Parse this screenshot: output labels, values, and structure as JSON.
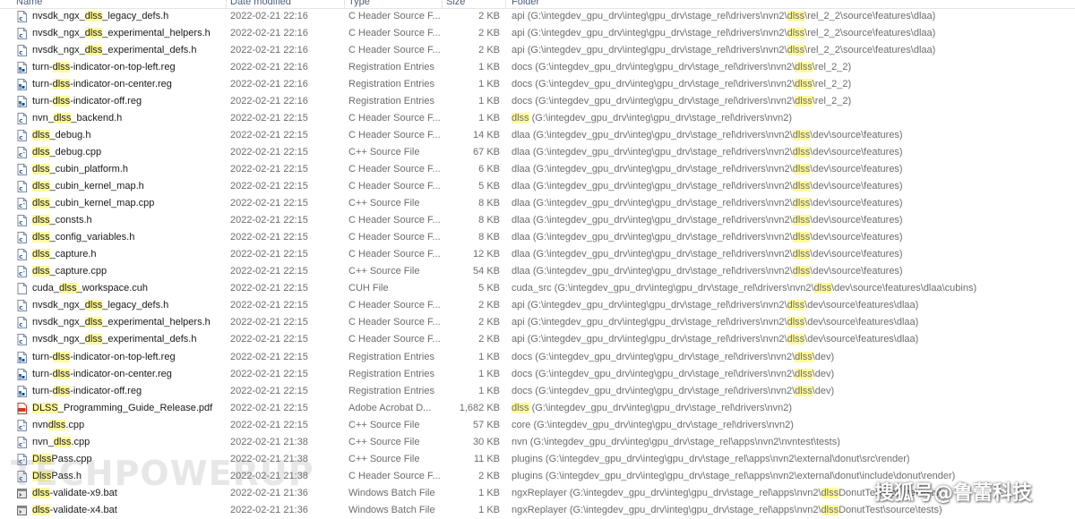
{
  "columns": {
    "name": "Name",
    "date": "Date modified",
    "type": "Type",
    "size": "Size",
    "folder": "Folder"
  },
  "highlight_term": "dlss",
  "highlight_color": "#fffa9a",
  "rows": [
    {
      "icon": "c-header-file-icon",
      "name": "nvsdk_ngx_dlss_legacy_defs.h",
      "date": "2022-02-21 22:16",
      "type": "C Header Source F...",
      "size": "2 KB",
      "folder": "api (G:\\integdev_gpu_drv\\integ\\gpu_drv\\stage_rel\\drivers\\nvn2\\dlss\\rel_2_2\\source\\features\\dlaa)"
    },
    {
      "icon": "c-header-file-icon",
      "name": "nvsdk_ngx_dlss_experimental_helpers.h",
      "date": "2022-02-21 22:16",
      "type": "C Header Source F...",
      "size": "2 KB",
      "folder": "api (G:\\integdev_gpu_drv\\integ\\gpu_drv\\stage_rel\\drivers\\nvn2\\dlss\\rel_2_2\\source\\features\\dlaa)"
    },
    {
      "icon": "c-header-file-icon",
      "name": "nvsdk_ngx_dlss_experimental_defs.h",
      "date": "2022-02-21 22:16",
      "type": "C Header Source F...",
      "size": "2 KB",
      "folder": "api (G:\\integdev_gpu_drv\\integ\\gpu_drv\\stage_rel\\drivers\\nvn2\\dlss\\rel_2_2\\source\\features\\dlaa)"
    },
    {
      "icon": "registry-file-icon",
      "name": "turn-dlss-indicator-on-top-left.reg",
      "date": "2022-02-21 22:16",
      "type": "Registration Entries",
      "size": "1 KB",
      "folder": "docs (G:\\integdev_gpu_drv\\integ\\gpu_drv\\stage_rel\\drivers\\nvn2\\dlss\\rel_2_2)"
    },
    {
      "icon": "registry-file-icon",
      "name": "turn-dlss-indicator-on-center.reg",
      "date": "2022-02-21 22:16",
      "type": "Registration Entries",
      "size": "1 KB",
      "folder": "docs (G:\\integdev_gpu_drv\\integ\\gpu_drv\\stage_rel\\drivers\\nvn2\\dlss\\rel_2_2)"
    },
    {
      "icon": "registry-file-icon",
      "name": "turn-dlss-indicator-off.reg",
      "date": "2022-02-21 22:16",
      "type": "Registration Entries",
      "size": "1 KB",
      "folder": "docs (G:\\integdev_gpu_drv\\integ\\gpu_drv\\stage_rel\\drivers\\nvn2\\dlss\\rel_2_2)"
    },
    {
      "icon": "c-header-file-icon",
      "name": "nvn_dlss_backend.h",
      "date": "2022-02-21 22:15",
      "type": "C Header Source F...",
      "size": "1 KB",
      "folder": "dlss (G:\\integdev_gpu_drv\\integ\\gpu_drv\\stage_rel\\drivers\\nvn2)"
    },
    {
      "icon": "c-header-file-icon",
      "name": "dlss_debug.h",
      "date": "2022-02-21 22:15",
      "type": "C Header Source F...",
      "size": "14 KB",
      "folder": "dlaa (G:\\integdev_gpu_drv\\integ\\gpu_drv\\stage_rel\\drivers\\nvn2\\dlss\\dev\\source\\features)"
    },
    {
      "icon": "cpp-source-file-icon",
      "name": "dlss_debug.cpp",
      "date": "2022-02-21 22:15",
      "type": "C++ Source File",
      "size": "67 KB",
      "folder": "dlaa (G:\\integdev_gpu_drv\\integ\\gpu_drv\\stage_rel\\drivers\\nvn2\\dlss\\dev\\source\\features)"
    },
    {
      "icon": "c-header-file-icon",
      "name": "dlss_cubin_platform.h",
      "date": "2022-02-21 22:15",
      "type": "C Header Source F...",
      "size": "6 KB",
      "folder": "dlaa (G:\\integdev_gpu_drv\\integ\\gpu_drv\\stage_rel\\drivers\\nvn2\\dlss\\dev\\source\\features)"
    },
    {
      "icon": "c-header-file-icon",
      "name": "dlss_cubin_kernel_map.h",
      "date": "2022-02-21 22:15",
      "type": "C Header Source F...",
      "size": "5 KB",
      "folder": "dlaa (G:\\integdev_gpu_drv\\integ\\gpu_drv\\stage_rel\\drivers\\nvn2\\dlss\\dev\\source\\features)"
    },
    {
      "icon": "cpp-source-file-icon",
      "name": "dlss_cubin_kernel_map.cpp",
      "date": "2022-02-21 22:15",
      "type": "C++ Source File",
      "size": "8 KB",
      "folder": "dlaa (G:\\integdev_gpu_drv\\integ\\gpu_drv\\stage_rel\\drivers\\nvn2\\dlss\\dev\\source\\features)"
    },
    {
      "icon": "c-header-file-icon",
      "name": "dlss_consts.h",
      "date": "2022-02-21 22:15",
      "type": "C Header Source F...",
      "size": "8 KB",
      "folder": "dlaa (G:\\integdev_gpu_drv\\integ\\gpu_drv\\stage_rel\\drivers\\nvn2\\dlss\\dev\\source\\features)"
    },
    {
      "icon": "c-header-file-icon",
      "name": "dlss_config_variables.h",
      "date": "2022-02-21 22:15",
      "type": "C Header Source F...",
      "size": "8 KB",
      "folder": "dlaa (G:\\integdev_gpu_drv\\integ\\gpu_drv\\stage_rel\\drivers\\nvn2\\dlss\\dev\\source\\features)"
    },
    {
      "icon": "c-header-file-icon",
      "name": "dlss_capture.h",
      "date": "2022-02-21 22:15",
      "type": "C Header Source F...",
      "size": "12 KB",
      "folder": "dlaa (G:\\integdev_gpu_drv\\integ\\gpu_drv\\stage_rel\\drivers\\nvn2\\dlss\\dev\\source\\features)"
    },
    {
      "icon": "cpp-source-file-icon",
      "name": "dlss_capture.cpp",
      "date": "2022-02-21 22:15",
      "type": "C++ Source File",
      "size": "54 KB",
      "folder": "dlaa (G:\\integdev_gpu_drv\\integ\\gpu_drv\\stage_rel\\drivers\\nvn2\\dlss\\dev\\source\\features)"
    },
    {
      "icon": "blank-file-icon",
      "name": "cuda_dlss_workspace.cuh",
      "date": "2022-02-21 22:15",
      "type": "CUH File",
      "size": "5 KB",
      "folder": "cuda_src (G:\\integdev_gpu_drv\\integ\\gpu_drv\\stage_rel\\drivers\\nvn2\\dlss\\dev\\source\\features\\dlaa\\cubins)"
    },
    {
      "icon": "c-header-file-icon",
      "name": "nvsdk_ngx_dlss_legacy_defs.h",
      "date": "2022-02-21 22:15",
      "type": "C Header Source F...",
      "size": "2 KB",
      "folder": "api (G:\\integdev_gpu_drv\\integ\\gpu_drv\\stage_rel\\drivers\\nvn2\\dlss\\dev\\source\\features\\dlaa)"
    },
    {
      "icon": "c-header-file-icon",
      "name": "nvsdk_ngx_dlss_experimental_helpers.h",
      "date": "2022-02-21 22:15",
      "type": "C Header Source F...",
      "size": "2 KB",
      "folder": "api (G:\\integdev_gpu_drv\\integ\\gpu_drv\\stage_rel\\drivers\\nvn2\\dlss\\dev\\source\\features\\dlaa)"
    },
    {
      "icon": "c-header-file-icon",
      "name": "nvsdk_ngx_dlss_experimental_defs.h",
      "date": "2022-02-21 22:15",
      "type": "C Header Source F...",
      "size": "2 KB",
      "folder": "api (G:\\integdev_gpu_drv\\integ\\gpu_drv\\stage_rel\\drivers\\nvn2\\dlss\\dev\\source\\features\\dlaa)"
    },
    {
      "icon": "registry-file-icon",
      "name": "turn-dlss-indicator-on-top-left.reg",
      "date": "2022-02-21 22:15",
      "type": "Registration Entries",
      "size": "1 KB",
      "folder": "docs (G:\\integdev_gpu_drv\\integ\\gpu_drv\\stage_rel\\drivers\\nvn2\\dlss\\dev)"
    },
    {
      "icon": "registry-file-icon",
      "name": "turn-dlss-indicator-on-center.reg",
      "date": "2022-02-21 22:15",
      "type": "Registration Entries",
      "size": "1 KB",
      "folder": "docs (G:\\integdev_gpu_drv\\integ\\gpu_drv\\stage_rel\\drivers\\nvn2\\dlss\\dev)"
    },
    {
      "icon": "registry-file-icon",
      "name": "turn-dlss-indicator-off.reg",
      "date": "2022-02-21 22:15",
      "type": "Registration Entries",
      "size": "1 KB",
      "folder": "docs (G:\\integdev_gpu_drv\\integ\\gpu_drv\\stage_rel\\drivers\\nvn2\\dlss\\dev)"
    },
    {
      "icon": "pdf-file-icon",
      "name": "DLSS_Programming_Guide_Release.pdf",
      "date": "2022-02-21 22:15",
      "type": "Adobe Acrobat D...",
      "size": "1,682 KB",
      "folder": "dlss (G:\\integdev_gpu_drv\\integ\\gpu_drv\\stage_rel\\drivers\\nvn2)"
    },
    {
      "icon": "cpp-source-file-icon",
      "name": "nvndlss.cpp",
      "date": "2022-02-21 22:15",
      "type": "C++ Source File",
      "size": "57 KB",
      "folder": "core (G:\\integdev_gpu_drv\\integ\\gpu_drv\\stage_rel\\drivers\\nvn2)"
    },
    {
      "icon": "cpp-source-file-icon",
      "name": "nvn_dlss.cpp",
      "date": "2022-02-21 21:38",
      "type": "C++ Source File",
      "size": "30 KB",
      "folder": "nvn (G:\\integdev_gpu_drv\\integ\\gpu_drv\\stage_rel\\apps\\nvn2\\nvntest\\tests)"
    },
    {
      "icon": "cpp-source-file-icon",
      "name": "DlssPass.cpp",
      "date": "2022-02-21 21:38",
      "type": "C++ Source File",
      "size": "11 KB",
      "folder": "plugins (G:\\integdev_gpu_drv\\integ\\gpu_drv\\stage_rel\\apps\\nvn2\\external\\donut\\src\\render)"
    },
    {
      "icon": "c-header-file-icon",
      "name": "DlssPass.h",
      "date": "2022-02-21 21:38",
      "type": "C Header Source F...",
      "size": "2 KB",
      "folder": "plugins (G:\\integdev_gpu_drv\\integ\\gpu_drv\\stage_rel\\apps\\nvn2\\external\\donut\\include\\donut\\render)"
    },
    {
      "icon": "batch-file-icon",
      "name": "dlss-validate-x9.bat",
      "date": "2022-02-21 21:36",
      "type": "Windows Batch File",
      "size": "1 KB",
      "folder": "ngxReplayer (G:\\integdev_gpu_drv\\integ\\gpu_drv\\stage_rel\\apps\\nvn2\\dlssDonutTest\\source\\tests)"
    },
    {
      "icon": "batch-file-icon",
      "name": "dlss-validate-x4.bat",
      "date": "2022-02-21 21:36",
      "type": "Windows Batch File",
      "size": "1 KB",
      "folder": "ngxReplayer (G:\\integdev_gpu_drv\\integ\\gpu_drv\\stage_rel\\apps\\nvn2\\dlssDonutTest\\source\\tests)"
    }
  ],
  "watermark": "TECHPOWERUP",
  "credit": "搜狐号@鲁蕾科技"
}
